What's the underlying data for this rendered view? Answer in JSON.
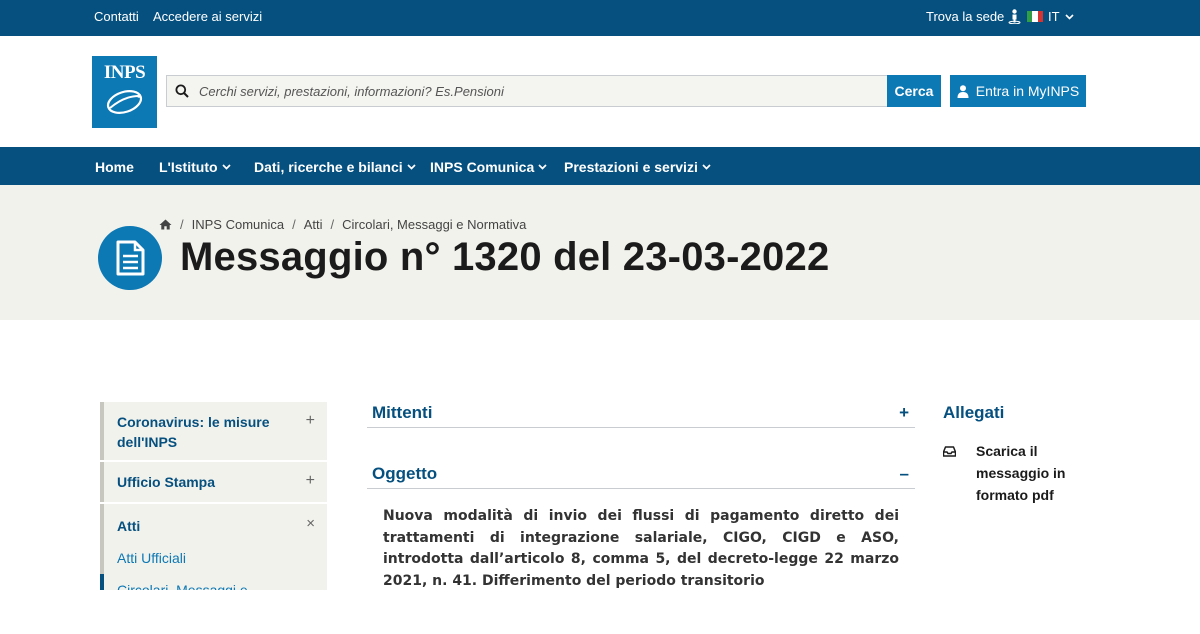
{
  "topbar": {
    "links": [
      "Contatti",
      "Accedere ai servizi"
    ],
    "trova_sede": "Trova la sede",
    "language": "IT"
  },
  "header": {
    "logo_text": "INPS",
    "search_placeholder": "Cerchi servizi, prestazioni, informazioni? Es.Pensioni",
    "search_button": "Cerca",
    "login_button": "Entra in MyINPS"
  },
  "nav": {
    "items": [
      "Home",
      "L'Istituto",
      "Dati, ricerche e bilanci",
      "INPS Comunica",
      "Prestazioni e servizi"
    ]
  },
  "breadcrumb": [
    "INPS Comunica",
    "Atti",
    "Circolari, Messaggi e Normativa"
  ],
  "page_title": "Messaggio n° 1320 del 23-03-2022",
  "sidebar": {
    "items": [
      {
        "label": "Coronavirus: le misure dell'INPS",
        "toggle": "+"
      },
      {
        "label": "Ufficio Stampa",
        "toggle": "+"
      },
      {
        "label": "Atti",
        "toggle": "×"
      }
    ],
    "subitems": [
      "Atti Ufficiali",
      "Circolari, Messaggi e"
    ]
  },
  "sections": {
    "mittenti": {
      "label": "Mittenti",
      "toggle": "+"
    },
    "oggetto": {
      "label": "Oggetto",
      "toggle": "–"
    },
    "oggetto_text": "Nuova modalità di invio dei flussi di pagamento diretto dei trattamenti di integrazione salariale, CIGO, CIGD e ASO, introdotta dall’articolo 8, comma 5, del decreto-legge 22 marzo 2021, n. 41. Differimento del periodo transitorio"
  },
  "allegati": {
    "title": "Allegati",
    "link": "Scarica il messaggio in formato pdf"
  },
  "colors": {
    "dark_blue": "#06507f",
    "accent_blue": "#0c78b4",
    "hero_bg": "#f2f2ed"
  }
}
